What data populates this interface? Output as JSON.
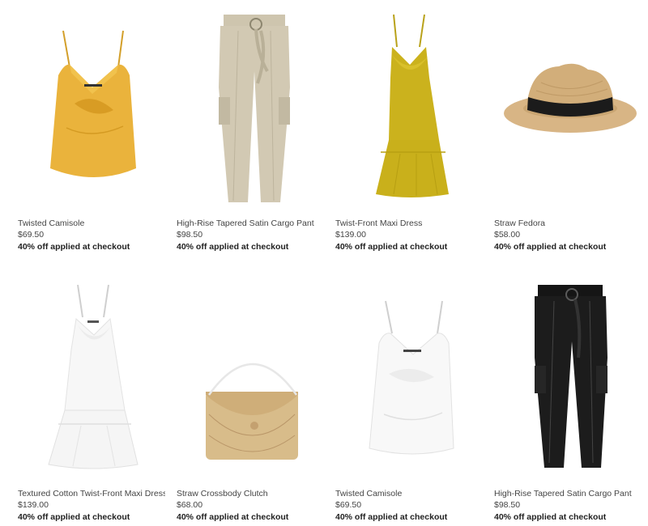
{
  "products": [
    {
      "title": "Twisted Camisole",
      "price": "$69.50",
      "promo": "40% off applied at checkout",
      "icon": "yellow-camisole"
    },
    {
      "title": "High-Rise Tapered Satin Cargo Pant",
      "price": "$98.50",
      "promo": "40% off applied at checkout",
      "icon": "khaki-satin-cargo-pant"
    },
    {
      "title": "Twist-Front Maxi Dress",
      "price": "$139.00",
      "promo": "40% off applied at checkout",
      "icon": "yellow-maxi-dress"
    },
    {
      "title": "Straw Fedora",
      "price": "$58.00",
      "promo": "40% off applied at checkout",
      "icon": "straw-fedora-hat"
    },
    {
      "title": "Textured Cotton Twist-Front Maxi Dress",
      "price": "$139.00",
      "promo": "40% off applied at checkout",
      "icon": "white-maxi-dress"
    },
    {
      "title": "Straw Crossbody Clutch",
      "price": "$68.00",
      "promo": "40% off applied at checkout",
      "icon": "straw-clutch-bag"
    },
    {
      "title": "Twisted Camisole",
      "price": "$69.50",
      "promo": "40% off applied at checkout",
      "icon": "white-camisole"
    },
    {
      "title": "High-Rise Tapered Satin Cargo Pant",
      "price": "$98.50",
      "promo": "40% off applied at checkout",
      "icon": "black-satin-cargo-pant"
    }
  ],
  "colors": {
    "yellow": "#e8b53a",
    "mustard": "#c9b21c",
    "khaki": "#cfc6b0",
    "straw": "#d6b27f",
    "black": "#1a1a1a",
    "white": "#f7f7f7"
  }
}
